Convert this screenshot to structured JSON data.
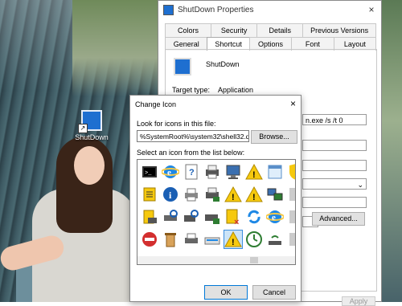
{
  "desktop": {
    "icon_label": "ShutDown"
  },
  "properties": {
    "title": "ShutDown Properties",
    "close_label": "×",
    "tabs_row1": [
      "Colors",
      "Security",
      "Details",
      "Previous Versions"
    ],
    "tabs_row2": [
      "General",
      "Shortcut",
      "Options",
      "Font",
      "Layout"
    ],
    "shortcut_name": "ShutDown",
    "target_type_label": "Target type:",
    "target_type_value": "Application",
    "target_field_value": "n.exe /s /t 0",
    "advanced_button": "Advanced...",
    "apply_button": "Apply"
  },
  "dialog": {
    "title": "Change Icon",
    "close_label": "×",
    "look_for_label": "Look for icons in this file:",
    "path_value": "%SystemRoot%\\system32\\shell32.d",
    "browse_button": "Browse...",
    "select_label": "Select an icon from the list below:",
    "ok_button": "OK",
    "cancel_button": "Cancel",
    "icons_row1": [
      "command-prompt-icon",
      "internet-explorer-icon",
      "help-document-icon",
      "network-printer-icon",
      "computer-icon",
      "warning-icon",
      "window-icon",
      "shield-icon"
    ],
    "icons_row2": [
      "list-document-icon",
      "info-icon",
      "printer-icon",
      "network-printer-icon",
      "warning-icon",
      "warning-icon",
      "network-computer-icon",
      "unknown-icon"
    ],
    "icons_row3": [
      "printer-document-icon",
      "printer-search-icon",
      "network-search-icon",
      "network-group-icon",
      "delete-file-icon",
      "refresh-icon",
      "internet-explorer-icon",
      "unknown-icon"
    ],
    "icons_row4": [
      "no-entry-icon",
      "recycle-bin-icon",
      "desktop-printer-icon",
      "scanner-icon",
      "warning-icon",
      "clock-icon",
      "wireless-icon",
      "unknown-icon"
    ]
  }
}
